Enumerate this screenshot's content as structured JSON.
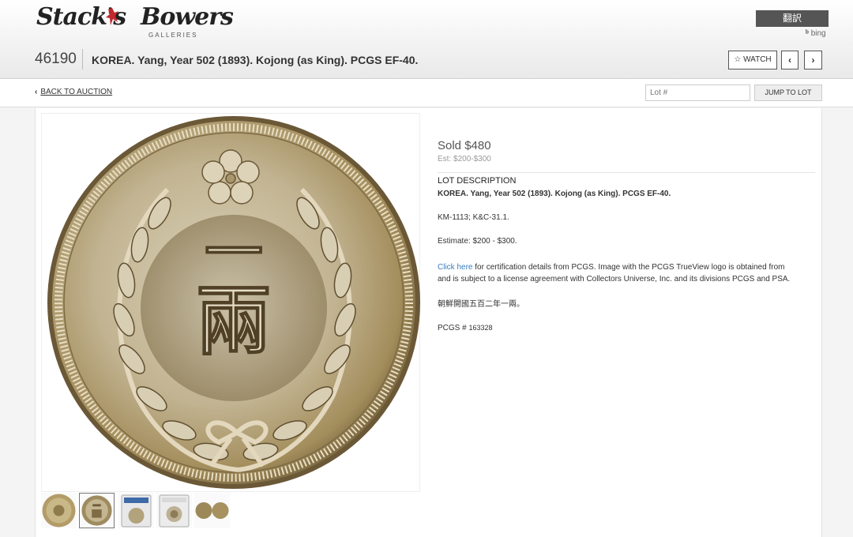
{
  "header": {
    "logo": {
      "name": "Stack's Bowers",
      "subtitle": "GALLERIES"
    },
    "translate_label": "翻訳",
    "bing_label": "bing",
    "lot_number": "46190",
    "lot_title": "KOREA. Yang, Year 502 (1893). Kojong (as King). PCGS EF-40.",
    "watch_label": "WATCH",
    "prev_icon": "chevron-left-icon",
    "next_icon": "chevron-right-icon"
  },
  "subnav": {
    "back_label": "BACK TO AUCTION",
    "lot_placeholder": "Lot #",
    "jump_label": "JUMP TO LOT"
  },
  "coin": {
    "center_top_char": "一",
    "center_bottom_char": "兩"
  },
  "thumbnails": [
    {
      "name": "coin-obverse-thumb",
      "active": false
    },
    {
      "name": "coin-reverse-thumb",
      "active": true
    },
    {
      "name": "slab-front-thumb",
      "active": false
    },
    {
      "name": "slab-back-thumb",
      "active": false
    },
    {
      "name": "coin-pair-thumb",
      "active": false
    }
  ],
  "details": {
    "sold": "Sold $480",
    "estimate_small": "Est: $200-$300",
    "desc_label": "LOT DESCRIPTION",
    "title_bold": "KOREA. Yang, Year 502 (1893). Kojong (as King). PCGS EF-40.",
    "catalog": "KM-1113; K&C-31.1.",
    "estimate": "Estimate: $200 - $300.",
    "cert_link": "Click here",
    "cert_text_1": " for certification details from PCGS. Image with the PCGS TrueView logo is obtained from",
    "cert_text_2": "and is subject to a license agreement with Collectors Universe, Inc. and its divisions PCGS and PSA.",
    "chinese": "朝鮮開國五百二年一兩。",
    "pcgs_label": "PCGS #",
    "pcgs_number": "163328"
  }
}
